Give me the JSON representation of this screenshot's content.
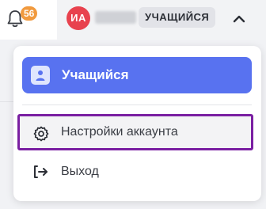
{
  "header": {
    "notifications": {
      "count": "56",
      "icon": "bell-icon"
    },
    "user": {
      "initials": "ИА",
      "avatar_color": "#e8424e",
      "role_chip": "УЧАЩИЙСЯ",
      "toggle_icon": "chevron-up-icon"
    }
  },
  "dropdown": {
    "active_role": {
      "label": "Учащийся",
      "icon": "person-icon",
      "accent": "#5872f0"
    },
    "items": [
      {
        "label": "Настройки аккаунта",
        "icon": "gear-icon",
        "highlight": "#7a1fa2"
      },
      {
        "label": "Выход",
        "icon": "logout-icon"
      }
    ]
  }
}
